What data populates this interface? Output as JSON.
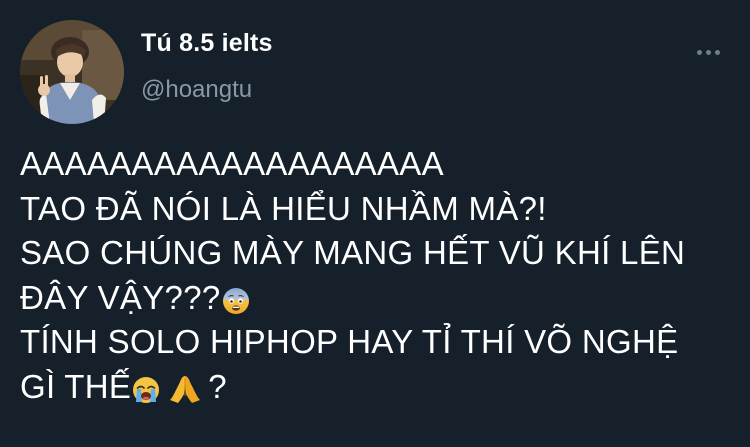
{
  "tweet": {
    "author": {
      "display_name": "Tú 8.5 ielts",
      "handle": "@hoangtu",
      "avatar_icon": "profile-photo"
    },
    "more_icon": "more-options-icon",
    "text_lines": [
      "AAAAAAAAAAAAAAAAAAA",
      "TAO ĐÃ NÓI LÀ HIỂU NHẦM MÀ?!",
      "SAO CHÚNG MÀY MANG HẾT VŨ KHÍ LÊN",
      "ĐÂY VẬY???",
      "TÍNH SOLO HIPHOP HAY TỈ THÍ VÕ NGHỆ",
      "GÌ THẾ"
    ],
    "text_tail": "?",
    "emojis": [
      "fearful-face-emoji",
      "loudly-crying-face-emoji",
      "folded-hands-emoji"
    ]
  },
  "colors": {
    "background": "#15202b",
    "text": "#ffffff",
    "secondary_text": "#8899a6"
  }
}
